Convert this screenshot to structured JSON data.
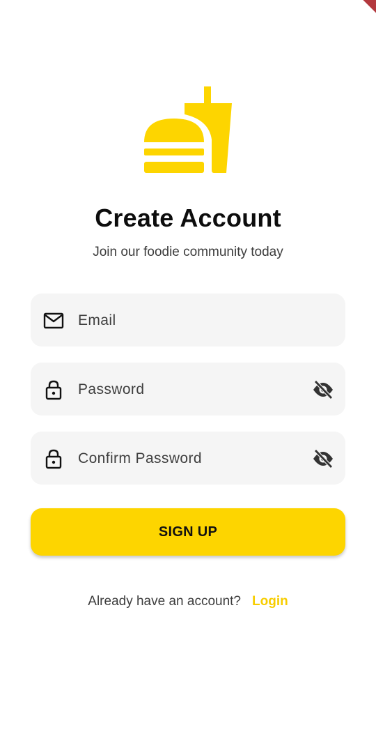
{
  "header": {
    "logo_icon": "burger-drink-icon",
    "title": "Create Account",
    "subtitle": "Join our foodie community today"
  },
  "form": {
    "email": {
      "icon": "mail-icon",
      "placeholder": "Email",
      "value": ""
    },
    "password": {
      "icon": "lock-icon",
      "placeholder": "Password",
      "value": "",
      "toggle_icon": "visibility-off-icon"
    },
    "confirm_password": {
      "icon": "lock-icon",
      "placeholder": "Confirm Password",
      "value": "",
      "toggle_icon": "visibility-off-icon"
    }
  },
  "signup_button": {
    "label": "SIGN UP"
  },
  "footer": {
    "prompt": "Already have an account?",
    "login_label": "Login"
  },
  "colors": {
    "accent": "#fdd500",
    "field_background": "#f5f5f5",
    "link": "#f7cd00"
  }
}
